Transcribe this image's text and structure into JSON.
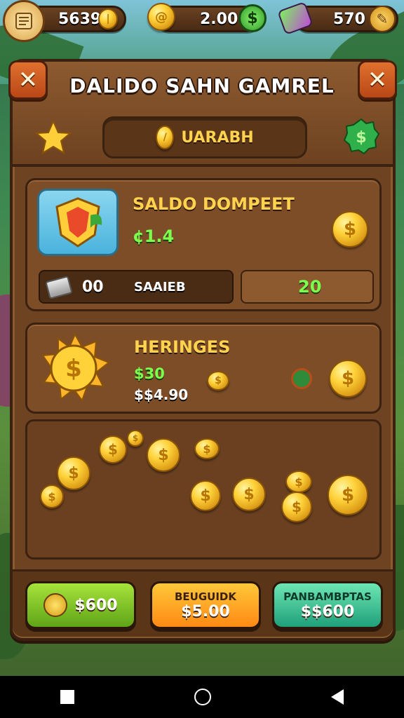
{
  "hud": {
    "scroll_value": "5639",
    "cash_value": "2.00",
    "gem_value": "570",
    "icons": [
      "scroll-icon",
      "coin-icon",
      "dollar-icon",
      "gem-icon",
      "settings-icon"
    ]
  },
  "panel": {
    "title": "DALIDO SAHN GAMREL",
    "close_left": "✕",
    "close_right": "✕",
    "search_label": "UARABH"
  },
  "card1": {
    "title": "SALDO DOMPEET",
    "value": "¢1.4",
    "left_count": "00",
    "left_label": "SAAIEB",
    "right_value": "20"
  },
  "card2": {
    "title": "HERINGES",
    "line1": "$30",
    "line2": "$$4.90"
  },
  "buttons": {
    "green_label": "$600",
    "orange_top": "BEUGUIDK",
    "orange_bottom": "$5.00",
    "teal_top": "PANBAMBPTAS",
    "teal_bottom": "$$600"
  },
  "colors": {
    "panel": "#6e4322",
    "gold": "#ffd34d",
    "green": "#7dff4d",
    "button_green": "#7cc425",
    "button_orange": "#ff9a1c",
    "button_teal": "#2fb98a"
  },
  "navbar": {
    "icons": [
      "recents-square-icon",
      "home-circle-icon",
      "back-triangle-icon"
    ]
  }
}
